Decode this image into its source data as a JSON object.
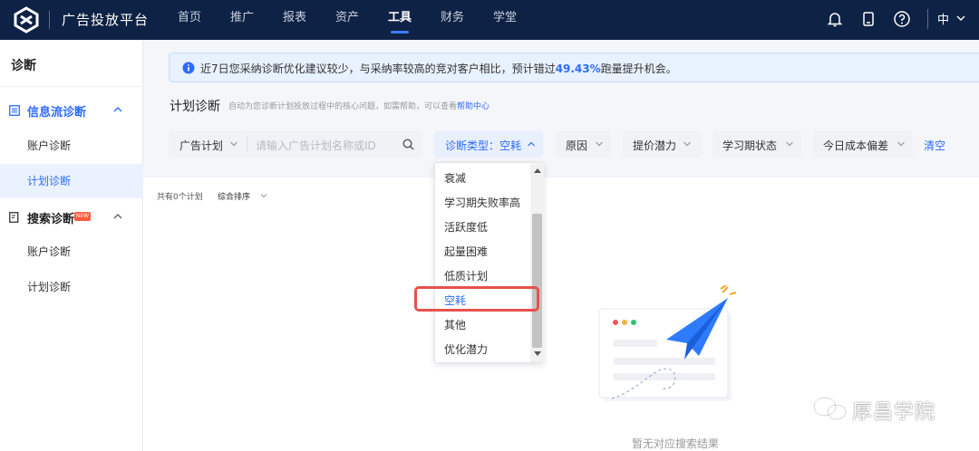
{
  "app": {
    "brand": "广告投放平台"
  },
  "nav": {
    "items": [
      "首页",
      "推广",
      "报表",
      "资产",
      "工具",
      "财务",
      "学堂"
    ],
    "active": "工具"
  },
  "topbar": {
    "lang": "中",
    "icons": [
      "bell-icon",
      "tablet-icon",
      "help-icon"
    ]
  },
  "sidebar": {
    "title": "诊断",
    "groups": [
      {
        "label": "信息流诊断",
        "icon": "list-icon",
        "items": [
          "账户诊断",
          "计划诊断"
        ],
        "badge": ""
      },
      {
        "label": "搜索诊断",
        "icon": "doc-search-icon",
        "items": [
          "账户诊断",
          "计划诊断"
        ],
        "badge": "NEW"
      }
    ],
    "active_item": "计划诊断"
  },
  "notice": {
    "prefix": "近7日您采纳诊断优化建议较少，与采纳率较高的竞对客户相比，预计错过",
    "highlight": "49.43%",
    "suffix": "跑量提升机会。"
  },
  "section": {
    "title": "计划诊断",
    "subtitle": "自动为您诊断计划投放过程中的核心问题，如需帮助，可以查看",
    "help_link": "帮助中心"
  },
  "filters": {
    "plan_select": "广告计划",
    "search_placeholder": "请输入广告计划名称或ID",
    "diag_type": "诊断类型：空耗",
    "reason": "原因",
    "bid_potential": "提价潜力",
    "learning_status": "学习期状态",
    "cost_deviation": "今日成本偏差",
    "clear": "清空"
  },
  "list": {
    "count": "共有0个计划",
    "sort": "综合排序"
  },
  "dropdown": {
    "options": [
      "衰减",
      "学习期失败率高",
      "活跃度低",
      "起量困难",
      "低质计划",
      "空耗",
      "其他",
      "优化潜力"
    ],
    "selected": "空耗"
  },
  "empty": {
    "text": "暂无对应搜索结果"
  },
  "watermark": {
    "text": "厚昌学院"
  },
  "colors": {
    "topbar": "#0e2245",
    "accent": "#2f6bff",
    "highlight_box": "#e8514d"
  }
}
